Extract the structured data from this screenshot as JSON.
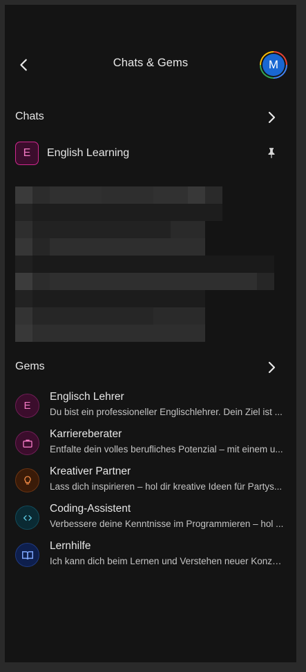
{
  "header": {
    "title": "Chats & Gems",
    "avatar_initial": "M"
  },
  "chats": {
    "section_title": "Chats",
    "pinned_item": {
      "initial": "E",
      "name": "English Learning"
    }
  },
  "gems": {
    "section_title": "Gems",
    "items": [
      {
        "name": "Englisch Lehrer",
        "description": "Du bist ein professioneller Englischlehrer. Dein Ziel ist ...",
        "icon": "letter-e-icon",
        "icon_text": "E",
        "color": "#f47ac4"
      },
      {
        "name": "Karriereberater",
        "description": "Entfalte dein volles berufliches Potenzial – mit einem u...",
        "icon": "briefcase-icon",
        "color": "#f47ac4"
      },
      {
        "name": "Kreativer Partner",
        "description": "Lass dich inspirieren – hol dir kreative Ideen für Partys...",
        "icon": "lightbulb-icon",
        "color": "#f28b45"
      },
      {
        "name": "Coding-Assistent",
        "description": "Verbessere deine Kenntnisse im Programmieren – hol ...",
        "icon": "code-icon",
        "color": "#5ec8e0"
      },
      {
        "name": "Lernhilfe",
        "description": "Ich kann dich beim Lernen und Verstehen neuer Konze...",
        "icon": "book-icon",
        "color": "#7fa8ff"
      }
    ]
  },
  "colors": {
    "background": "#141414",
    "text": "#e6e6e6",
    "pink_accent": "#d0288f",
    "avatar_blue": "#1967d2"
  }
}
